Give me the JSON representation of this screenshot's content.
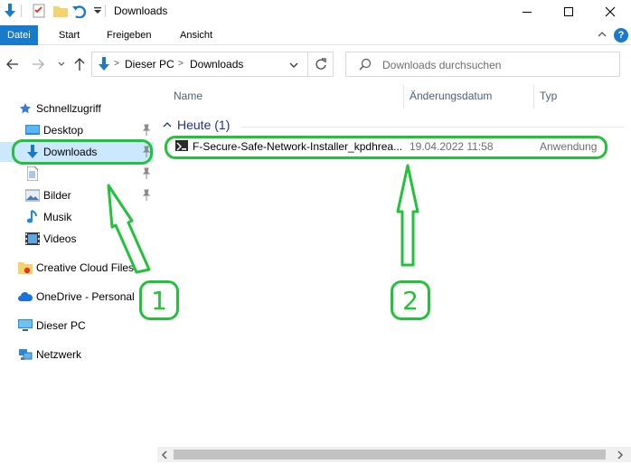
{
  "window": {
    "title": "Downloads",
    "controls": {
      "minimize": "minimize-icon",
      "maximize": "maximize-icon",
      "close": "close-icon"
    }
  },
  "ribbon": {
    "tabs": [
      "Datei",
      "Start",
      "Freigeben",
      "Ansicht"
    ]
  },
  "address": {
    "segments": [
      "Dieser PC",
      "Downloads"
    ],
    "separator": ">"
  },
  "search": {
    "placeholder": "Downloads durchsuchen"
  },
  "navigation": {
    "quick_access": "Schnellzugriff",
    "quick_items": [
      {
        "label": "Desktop",
        "icon": "desktop-icon",
        "pinned": true
      },
      {
        "label": "Downloads",
        "icon": "download-icon",
        "pinned": true,
        "selected": true
      },
      {
        "label": "",
        "icon": "document-icon",
        "pinned": true
      },
      {
        "label": "Bilder",
        "icon": "pictures-icon",
        "pinned": true
      },
      {
        "label": "Musik",
        "icon": "music-icon",
        "pinned": false
      },
      {
        "label": "Videos",
        "icon": "video-icon",
        "pinned": false
      }
    ],
    "other_items": [
      {
        "label": "Creative Cloud Files",
        "icon": "creative-cloud-folder-icon"
      },
      {
        "label": "OneDrive - Personal",
        "icon": "onedrive-cloud-icon"
      },
      {
        "label": "Dieser PC",
        "icon": "computer-icon"
      },
      {
        "label": "Netzwerk",
        "icon": "network-icon"
      }
    ]
  },
  "columns": [
    "Name",
    "Änderungsdatum",
    "Typ"
  ],
  "group": {
    "label": "Heute (1)"
  },
  "files": [
    {
      "name": "F-Secure-Safe-Network-Installer_kpdhrea...",
      "date": "19.04.2022 11:58",
      "type": "Anwendung"
    }
  ],
  "annotations": {
    "badge_1": "1",
    "badge_2": "2",
    "color": "#22c23a"
  },
  "colors": {
    "accent": "#1979ca",
    "selection": "#cce8ff",
    "group_text": "#1e3287"
  }
}
